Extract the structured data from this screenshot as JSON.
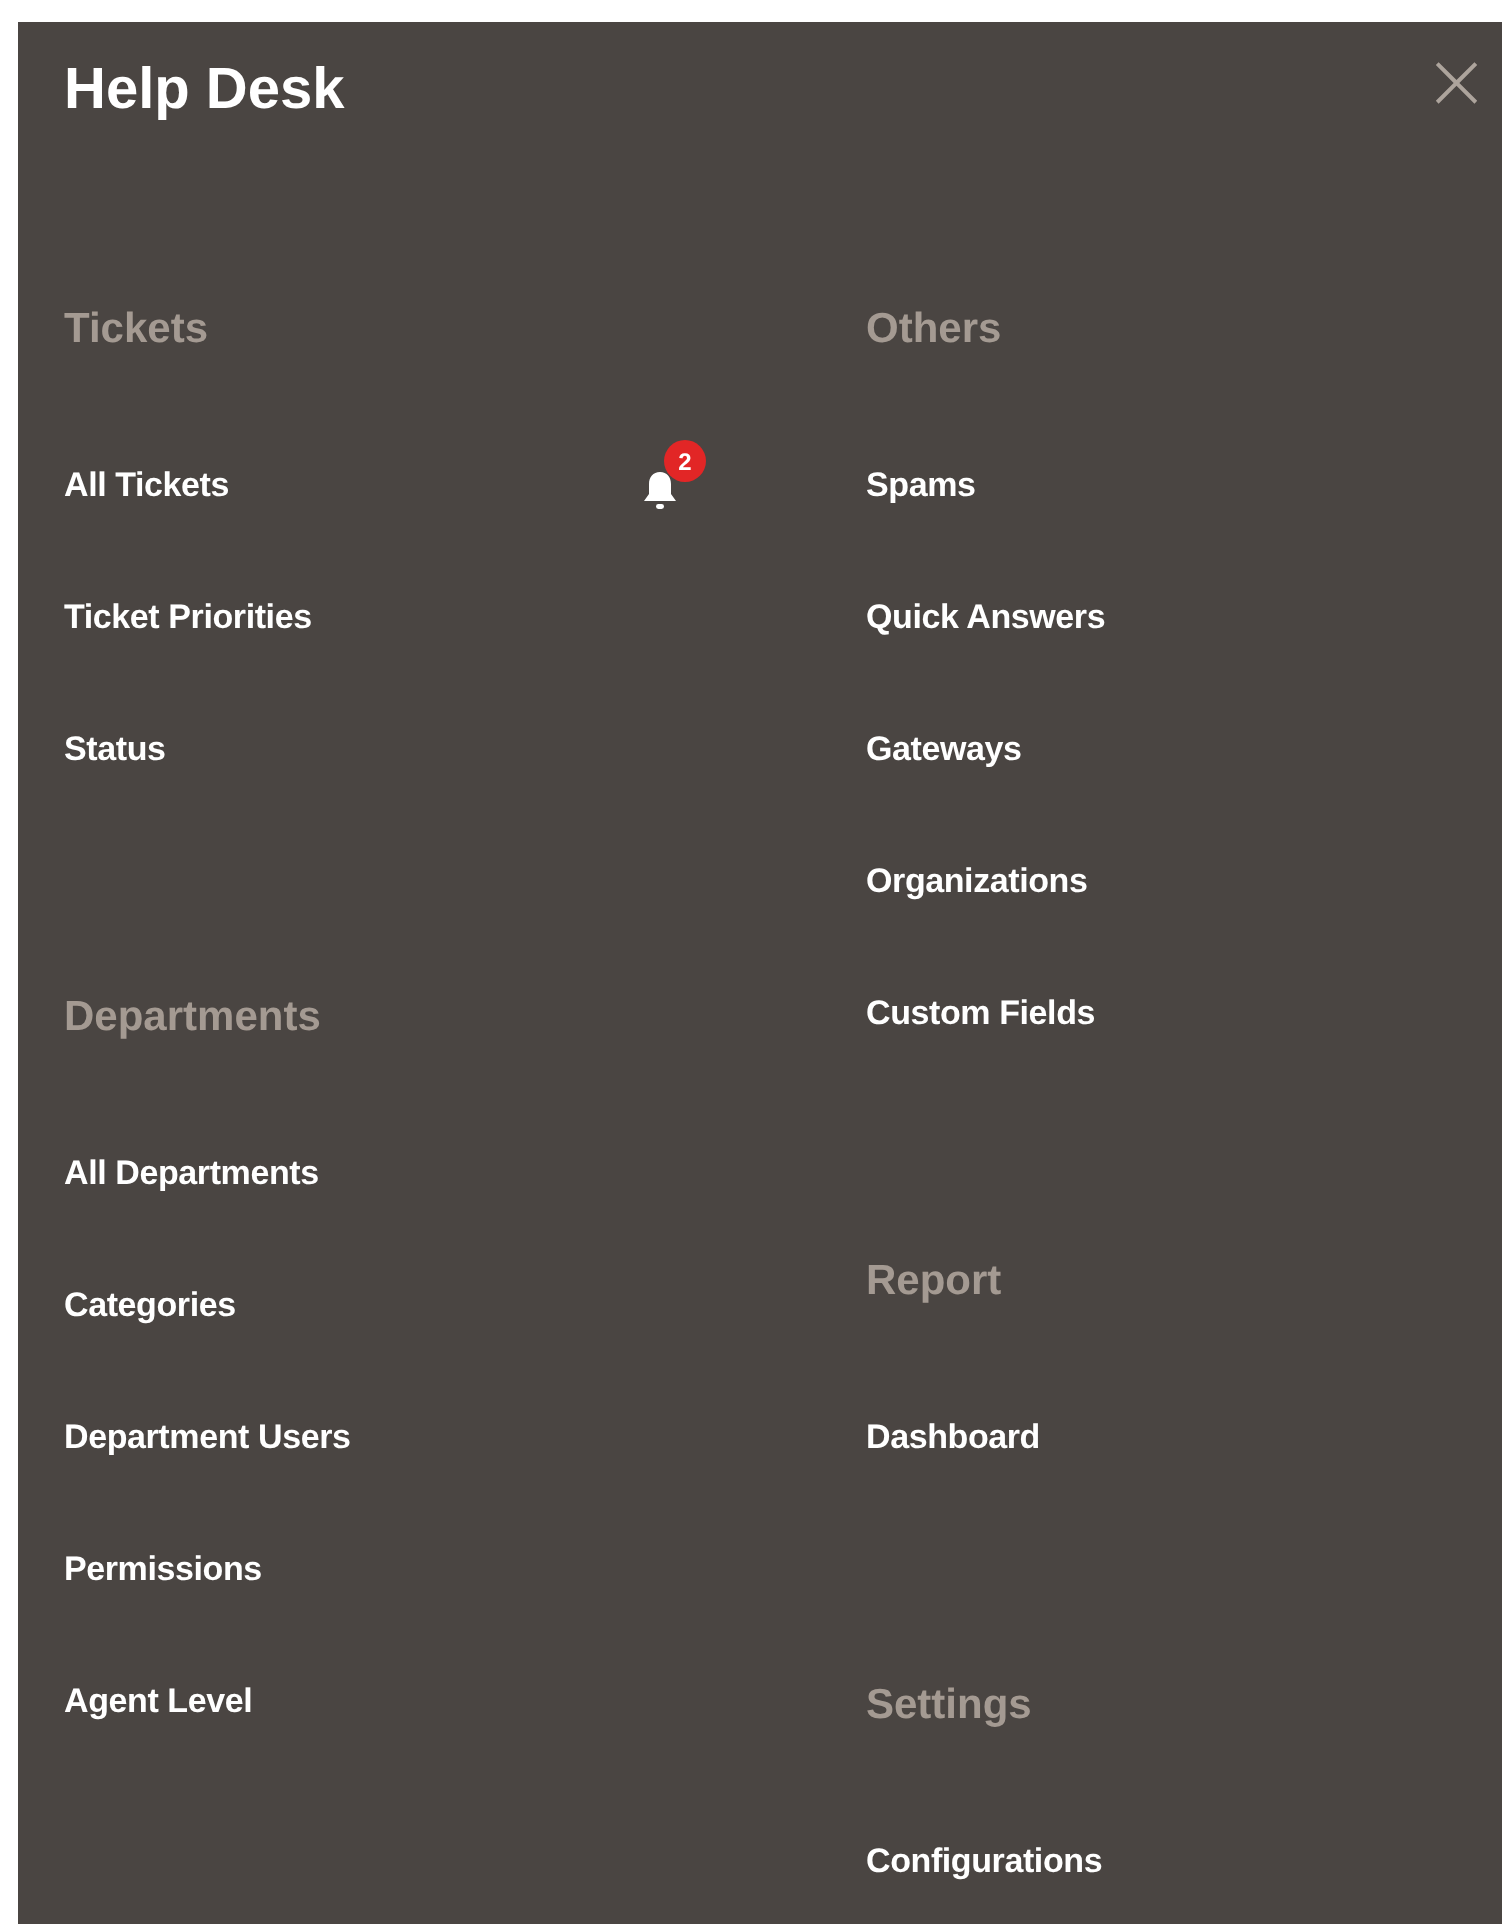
{
  "title": "Help Desk",
  "close": "×",
  "columns": [
    {
      "sections": [
        {
          "heading": "Tickets",
          "items": [
            {
              "label": "All Tickets",
              "badge": "2"
            },
            {
              "label": "Ticket Priorities"
            },
            {
              "label": "Status"
            }
          ]
        },
        {
          "heading": "Departments",
          "items": [
            {
              "label": "All Departments"
            },
            {
              "label": "Categories"
            },
            {
              "label": "Department Users"
            },
            {
              "label": "Permissions"
            },
            {
              "label": "Agent Level"
            }
          ]
        }
      ]
    },
    {
      "sections": [
        {
          "heading": "Others",
          "items": [
            {
              "label": "Spams"
            },
            {
              "label": "Quick Answers"
            },
            {
              "label": "Gateways"
            },
            {
              "label": "Organizations"
            },
            {
              "label": "Custom Fields"
            }
          ]
        },
        {
          "heading": "Report",
          "items": [
            {
              "label": "Dashboard"
            }
          ]
        },
        {
          "heading": "Settings",
          "items": [
            {
              "label": "Configurations"
            }
          ]
        }
      ]
    }
  ]
}
